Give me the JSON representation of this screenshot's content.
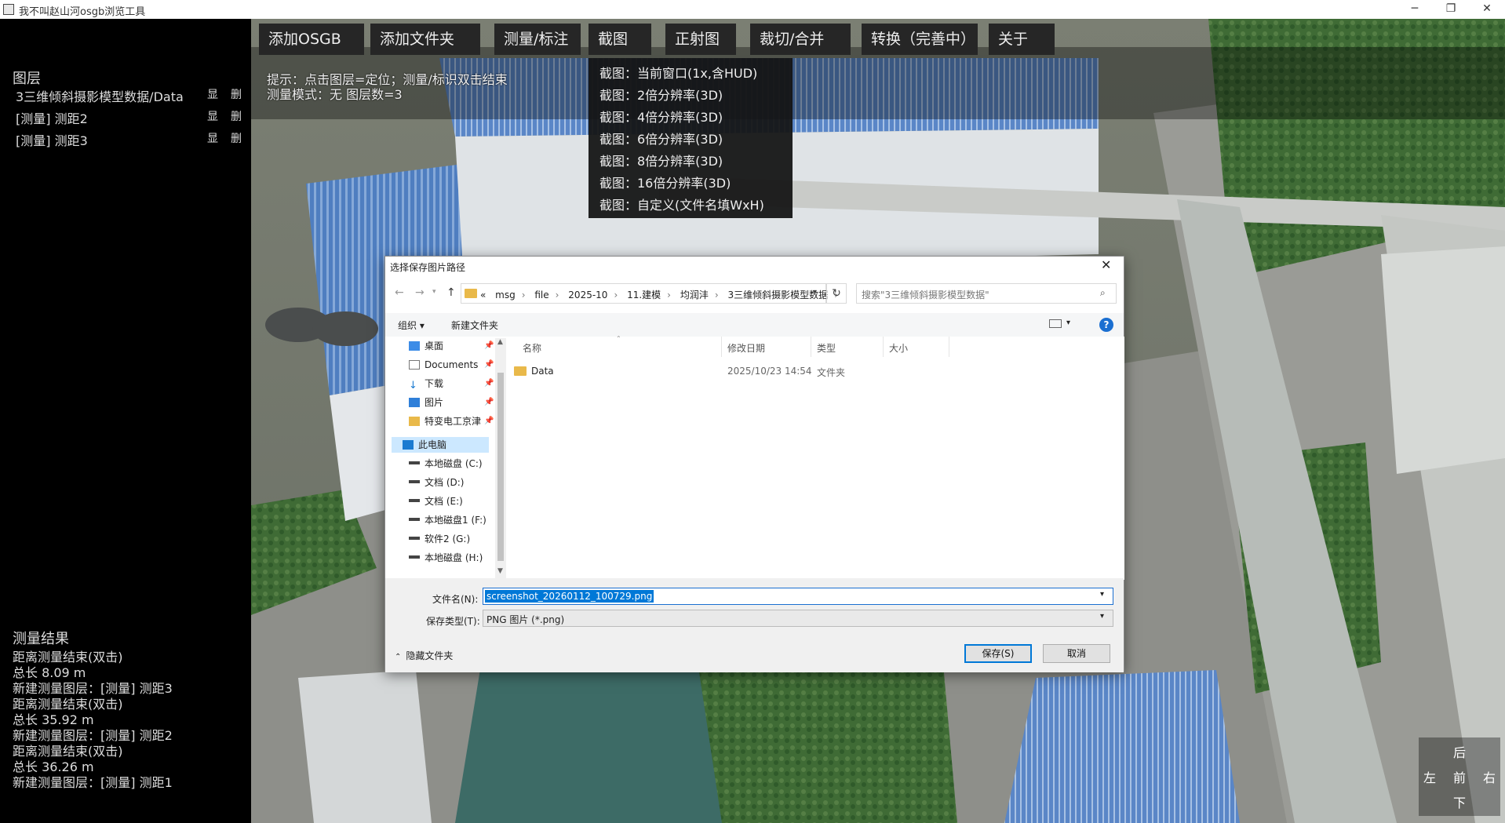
{
  "window": {
    "title": "我不叫赵山河osgb浏览工具",
    "min": "─",
    "max": "❐",
    "close": "✕"
  },
  "left": {
    "layers_title": "图层",
    "layers": [
      {
        "name": "3三维倾斜摄影模型数据/Data",
        "show": "显",
        "del": "删"
      },
      {
        "name": "[测量] 测距2",
        "show": "显",
        "del": "删"
      },
      {
        "name": "[测量] 测距3",
        "show": "显",
        "del": "删"
      }
    ],
    "results_title": "测量结果",
    "results": [
      "距离测量结束(双击)",
      "总长 8.09 m",
      "新建测量图层：[测量] 测距3",
      "距离测量结束(双击)",
      "总长 35.92 m",
      "新建测量图层：[测量] 测距2",
      "距离测量结束(双击)",
      "总长 36.26 m",
      "新建测量图层：[测量] 测距1"
    ]
  },
  "menu": [
    "添加OSGB",
    "添加文件夹",
    "测量/标注",
    "截图",
    "正射图",
    "裁切/合并",
    "转换（完善中）",
    "关于"
  ],
  "screenshot_menu": [
    "截图：当前窗口(1x,含HUD)",
    "截图：2倍分辨率(3D)",
    "截图：4倍分辨率(3D)",
    "截图：6倍分辨率(3D)",
    "截图：8倍分辨率(3D)",
    "截图：16倍分辨率(3D)",
    "截图：自定义(文件名填WxH)"
  ],
  "hint": {
    "line1": "提示：点击图层=定位；测量/标识双击结束",
    "line2": "测量模式：无  图层数=3"
  },
  "compass": {
    "back": "后",
    "left": "左",
    "front": "前",
    "right": "右",
    "down": "下"
  },
  "dialog": {
    "title": "选择保存图片路径",
    "close": "✕",
    "path": [
      "«",
      "msg",
      "file",
      "2025-10",
      "11.建模",
      "均润沣",
      "3三维倾斜摄影模型数据"
    ],
    "search_placeholder": "搜索\"3三维倾斜摄影模型数据\"",
    "toolbar": {
      "organize": "组织 ▾",
      "new_folder": "新建文件夹",
      "view": "▾",
      "help": "?"
    },
    "nav": [
      {
        "label": "桌面",
        "icon": "desktop-icon",
        "pinned": true
      },
      {
        "label": "Documents",
        "icon": "documents-icon",
        "pinned": true
      },
      {
        "label": "下载",
        "icon": "download-icon",
        "pinned": true
      },
      {
        "label": "图片",
        "icon": "pictures-icon",
        "pinned": true
      },
      {
        "label": "特变电工京津",
        "icon": "folder-icon",
        "pinned": true
      }
    ],
    "this_pc": "此电脑",
    "drives": [
      "本地磁盘 (C:)",
      "文档 (D:)",
      "文档 (E:)",
      "本地磁盘1 (F:)",
      "软件2 (G:)",
      "本地磁盘 (H:)"
    ],
    "columns": {
      "name": "名称",
      "date": "修改日期",
      "type": "类型",
      "size": "大小"
    },
    "files": [
      {
        "name": "Data",
        "date": "2025/10/23 14:54",
        "type": "文件夹",
        "size": ""
      }
    ],
    "filename_label": "文件名(N):",
    "filename_value": "screenshot_20260112_100729.png",
    "filetype_label": "保存类型(T):",
    "filetype_value": "PNG 图片 (*.png)",
    "hide_folders": "隐藏文件夹",
    "save": "保存(S)",
    "cancel": "取消"
  },
  "colors": {
    "accent": "#0078d7",
    "menu_bg": "#262626",
    "panel_bg": "#000000"
  }
}
